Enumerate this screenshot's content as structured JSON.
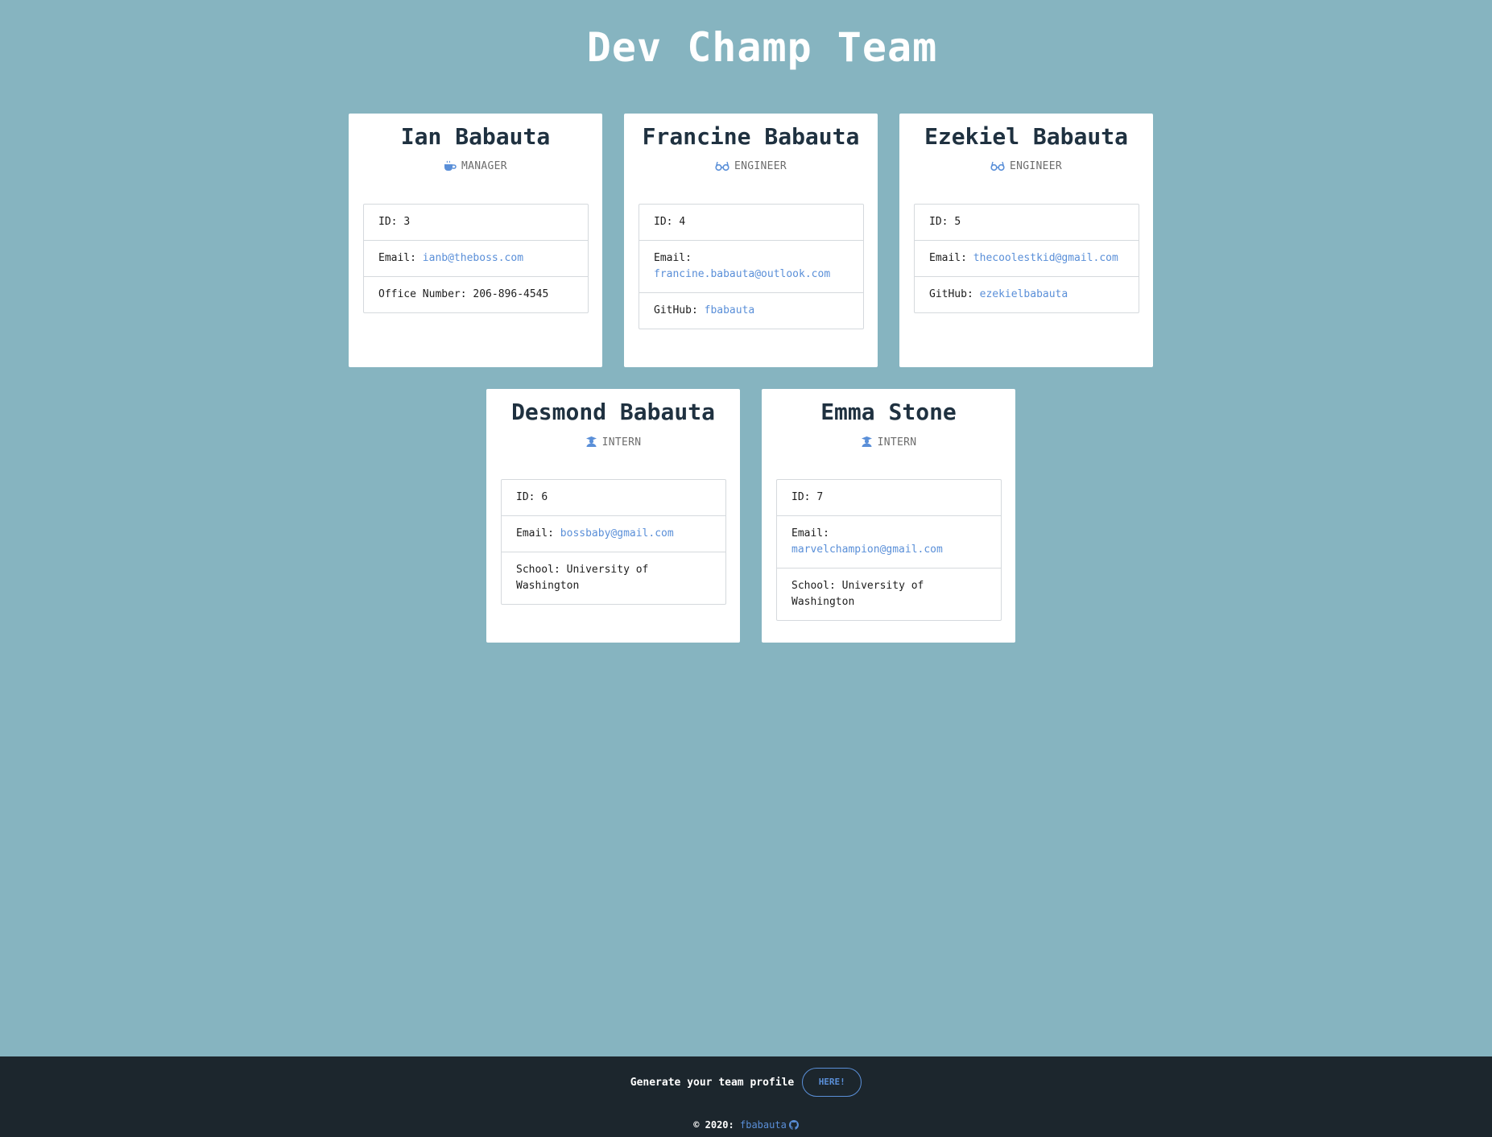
{
  "page": {
    "title": "Dev Champ Team"
  },
  "cards": [
    {
      "name": "Ian Babauta",
      "role": "MANAGER",
      "role_icon": "coffee-icon",
      "id_label": "ID:",
      "id": "3",
      "email_label": "Email:",
      "email": "ianb@theboss.com",
      "extra_label": "Office Number:",
      "extra": "206-896-4545"
    },
    {
      "name": "Francine Babauta",
      "role": "ENGINEER",
      "role_icon": "glasses-icon",
      "id_label": "ID:",
      "id": "4",
      "email_label": "Email:",
      "email": "francine.babauta@outlook.com",
      "extra_label": "GitHub:",
      "extra": "fbabauta"
    },
    {
      "name": "Ezekiel Babauta",
      "role": "ENGINEER",
      "role_icon": "glasses-icon",
      "id_label": "ID:",
      "id": "5",
      "email_label": "Email:",
      "email": "thecoolestkid@gmail.com",
      "extra_label": "GitHub:",
      "extra": "ezekielbabauta"
    },
    {
      "name": "Desmond Babauta",
      "role": "INTERN",
      "role_icon": "graduate-icon",
      "id_label": "ID:",
      "id": "6",
      "email_label": "Email:",
      "email": "bossbaby@gmail.com",
      "extra_label": "School:",
      "extra": "University of Washington"
    },
    {
      "name": "Emma Stone",
      "role": "INTERN",
      "role_icon": "graduate-icon",
      "id_label": "ID:",
      "id": "7",
      "email_label": "Email:",
      "email": "marvelchampion@gmail.com",
      "extra_label": "School:",
      "extra": "University of Washington"
    }
  ],
  "footer": {
    "generate_text": "Generate your team profile",
    "here_button": "HERE!",
    "copyright_text": "© 2020:",
    "author_link": "fbabauta",
    "author_icon": "github-icon"
  },
  "colors": {
    "background": "#86b4c0",
    "card": "#ffffff",
    "footer": "#1c262d",
    "link": "#5a8fd8",
    "name": "#1f3140"
  }
}
